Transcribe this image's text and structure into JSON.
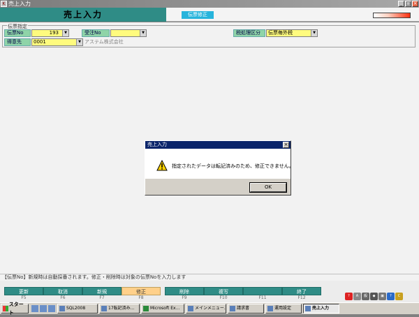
{
  "window": {
    "title": "売上入力"
  },
  "header": {
    "title": "売上入力",
    "mode": "伝票修正"
  },
  "group": {
    "label": "伝票指定",
    "slip_no_label": "伝票No",
    "slip_no_value": "193",
    "order_no_label": "受注No",
    "order_no_value": "",
    "tax_label": "税処理区分",
    "tax_value": "伝票毎外税",
    "customer_label": "得意先",
    "customer_code": "0001",
    "customer_name": "アステム株式会社"
  },
  "dialog": {
    "title": "売上入力",
    "message": "指定されたデータは転記済みのため、修正できません。",
    "ok_label": "OK"
  },
  "status": {
    "text": "【伝票No】新規時は自動採番されます。修正・削除時は対象の伝票Noを入力します"
  },
  "fkeys": [
    {
      "label": "更新",
      "key": "F5"
    },
    {
      "label": "取消",
      "key": "F6"
    },
    {
      "label": "新規",
      "key": "F7"
    },
    {
      "label": "修正",
      "key": "F8"
    },
    {
      "label": "削除",
      "key": "F9"
    },
    {
      "label": "複写",
      "key": "F10"
    },
    {
      "label": "",
      "key": "F11"
    },
    {
      "label": "終了",
      "key": "F12"
    }
  ],
  "taskbar": {
    "start": "スタート",
    "items": [
      "SQL2008",
      "17転記済み...",
      "Microsoft Ex...",
      "メインメニュー...",
      "請求書",
      "運用設定",
      "売上入力"
    ]
  },
  "colors": {
    "accent": "#2f8c86",
    "field": "#fffb7e",
    "label": "#8fd4a8",
    "mode": "#27b4dc"
  }
}
